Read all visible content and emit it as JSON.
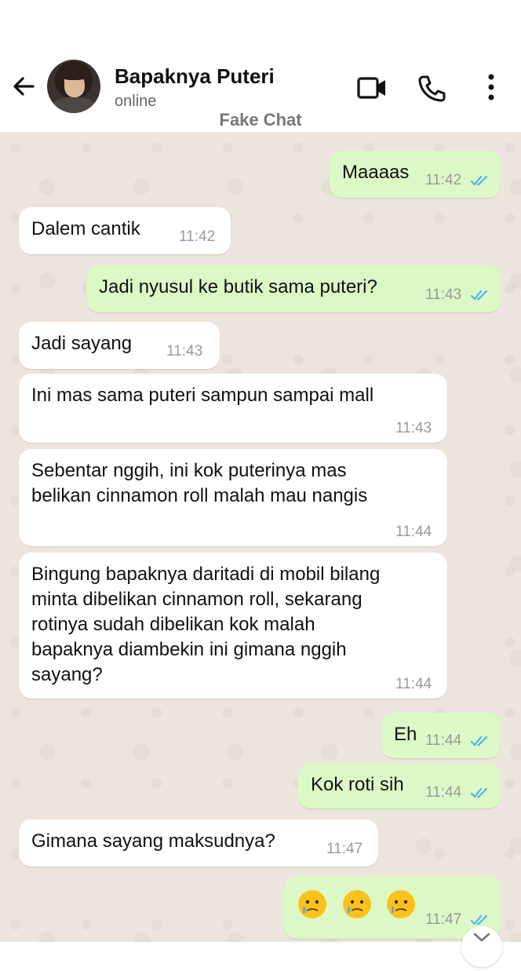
{
  "header": {
    "contact_name": "Bapaknya Puteri",
    "status": "online",
    "watermark": "Fake Chat",
    "icons": [
      "back-arrow-icon",
      "avatar",
      "video-call-icon",
      "phone-call-icon",
      "more-options-icon"
    ]
  },
  "colors": {
    "outgoing_bubble": "#dcf8c6",
    "incoming_bubble": "#ffffff",
    "chat_background": "#ece5dd",
    "read_tick": "#4fb6ec"
  },
  "messages": [
    {
      "dir": "out",
      "text": "Maaaas",
      "time": "11:42",
      "read": true
    },
    {
      "dir": "in",
      "text": "Dalem cantik",
      "time": "11:42"
    },
    {
      "dir": "out",
      "text": "Jadi nyusul ke butik sama puteri?",
      "time": "11:43",
      "read": true
    },
    {
      "dir": "in",
      "text": "Jadi sayang",
      "time": "11:43"
    },
    {
      "dir": "in",
      "lines": [
        "Ini mas sama puteri sampun sampai mall"
      ],
      "time": "11:43"
    },
    {
      "dir": "in",
      "lines": [
        "Sebentar nggih, ini kok puterinya mas",
        "belikan cinnamon roll malah mau nangis"
      ],
      "time": "11:44"
    },
    {
      "dir": "in",
      "lines": [
        "Bingung bapaknya daritadi di mobil bilang",
        "minta dibelikan cinnamon roll, sekarang",
        "rotinya sudah dibelikan kok malah",
        "bapaknya diambekin ini gimana nggih",
        "sayang?"
      ],
      "time": "11:44"
    },
    {
      "dir": "out",
      "text": "Eh",
      "time": "11:44",
      "read": true
    },
    {
      "dir": "out",
      "text": "Kok roti sih",
      "time": "11:44",
      "read": true
    },
    {
      "dir": "in",
      "text": "Gimana sayang maksudnya?",
      "time": "11:47"
    },
    {
      "dir": "out",
      "emoji": [
        "crying-face-emoji",
        "crying-face-emoji",
        "crying-face-emoji"
      ],
      "time": "11:47",
      "read": true
    }
  ]
}
